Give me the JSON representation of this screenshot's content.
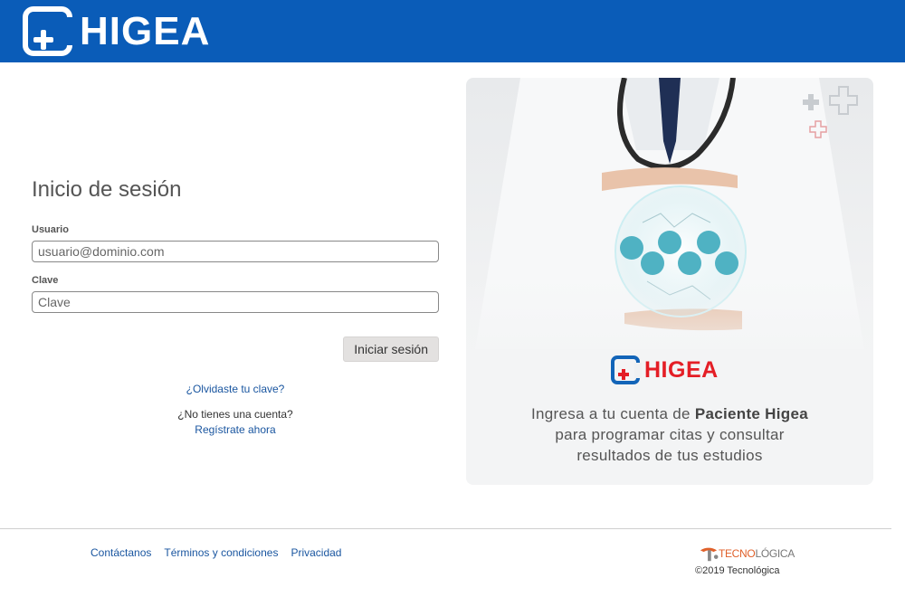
{
  "header": {
    "logo_text": "HIGEA",
    "bg_color": "#0a5cb8"
  },
  "login": {
    "title": "Inicio de sesión",
    "user_label": "Usuario",
    "user_placeholder": "usuario@dominio.com",
    "password_label": "Clave",
    "password_placeholder": "Clave",
    "submit_label": "Iniciar sesión",
    "forgot_link": "¿Olvidaste tu clave?",
    "no_account_text": "¿No tienes una cuenta?",
    "register_link": "Regístrate ahora"
  },
  "promo": {
    "logo_text": "HIGEA",
    "line1_pre": "Ingresa a tu cuenta de ",
    "line1_bold": "Paciente Higea",
    "line2": "para programar citas y consultar",
    "line3": "resultados de tus estudios"
  },
  "footer": {
    "links": [
      "Contáctanos",
      "Términos y condiciones",
      "Privacidad"
    ],
    "brand_red": "TECNO",
    "brand_gray": "LÓGICA",
    "copyright": "©2019 Tecnológica"
  },
  "colors": {
    "primary": "#0a5cb8",
    "accent_red": "#e41e26",
    "link": "#1a56a0"
  }
}
